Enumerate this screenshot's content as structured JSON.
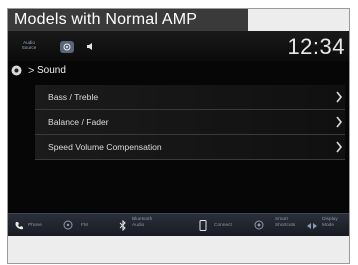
{
  "caption": "Models with Normal AMP",
  "status_bar": {
    "audio_source_line1": "Audio",
    "audio_source_line2": "Source",
    "clock": "12:34"
  },
  "breadcrumb": {
    "label": "Sound"
  },
  "menu": {
    "items": [
      {
        "label": "Bass / Treble"
      },
      {
        "label": "Balance / Fader"
      },
      {
        "label": "Speed Volume Compensation"
      }
    ]
  },
  "bottom_bar": {
    "phone": "Phone",
    "fm": "FM",
    "bluetooth_line1": "Bluetooth",
    "bluetooth_line2": "Audio",
    "connect": "Connect",
    "smart_line1": "Smart",
    "smart_line2": "Shortcuts",
    "display_line1": "Display",
    "display_line2": "Mode"
  },
  "colors": {
    "screen_bg": "#060606",
    "caption_bg": "#3a3a3a",
    "text": "#dcdcdc",
    "bottom_bar": "#1f232c",
    "bottom_label": "#8d97ad"
  }
}
